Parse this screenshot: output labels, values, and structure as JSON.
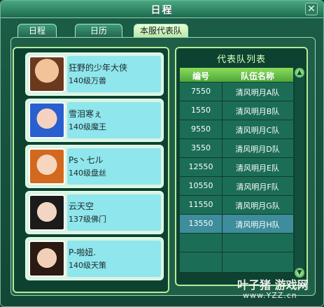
{
  "window": {
    "title": "日程"
  },
  "tabs": [
    {
      "label": "日程"
    },
    {
      "label": "日历"
    },
    {
      "label": "本服代表队",
      "active": true
    }
  ],
  "players": [
    {
      "name": "狂野的少年大侠",
      "level": "140级万兽",
      "avatar": "avatar-brown-hair"
    },
    {
      "name": "雪泪寒ぇ",
      "level": "140级魔王",
      "avatar": "avatar-blue-hair"
    },
    {
      "name": "Ρs丶七ル",
      "level": "140级盘丝",
      "avatar": "avatar-orange-hair"
    },
    {
      "name": "云天空",
      "level": "137级佛门",
      "avatar": "avatar-black-hair"
    },
    {
      "name": "P-啪妞.",
      "level": "140级天策",
      "avatar": "avatar-dark-hair"
    }
  ],
  "team_list": {
    "title": "代表队列表",
    "headers": {
      "number": "编号",
      "team_name": "队伍名称"
    },
    "rows": [
      {
        "number": "7550",
        "team_name": "清风明月A队"
      },
      {
        "number": "1550",
        "team_name": "清风明月B队"
      },
      {
        "number": "9550",
        "team_name": "清风明月C队"
      },
      {
        "number": "3550",
        "team_name": "清风明月D队"
      },
      {
        "number": "12550",
        "team_name": "清风明月E队"
      },
      {
        "number": "10550",
        "team_name": "清风明月F队"
      },
      {
        "number": "11550",
        "team_name": "清风明月G队"
      },
      {
        "number": "13550",
        "team_name": "清风明月H队",
        "selected": true
      }
    ]
  },
  "watermark": {
    "text": "叶子猪 游戏网",
    "url": "www.YZZ.cn"
  },
  "colors": {
    "accent": "#8bdc5a",
    "selected_row": "#3d8d9c"
  }
}
